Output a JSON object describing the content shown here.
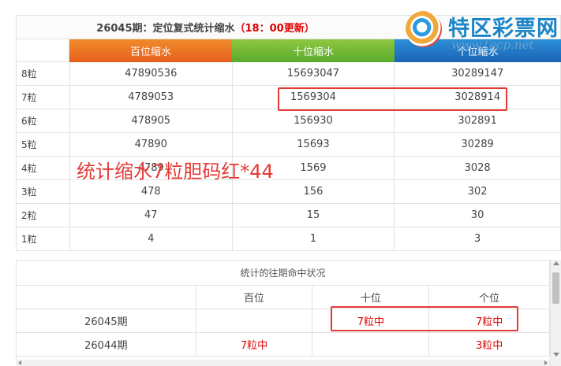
{
  "title": {
    "main": "26045期：定位复式统计缩水",
    "update": "（18：00更新）"
  },
  "columns": {
    "bai": "百位缩水",
    "shi": "十位缩水",
    "ge": "个位缩水"
  },
  "rows": [
    {
      "label": "8粒",
      "bai": "47890536",
      "shi": "15693047",
      "ge": "30289147"
    },
    {
      "label": "7粒",
      "bai": "4789053",
      "shi": "1569304",
      "ge": "3028914"
    },
    {
      "label": "6粒",
      "bai": "478905",
      "shi": "156930",
      "ge": "302891"
    },
    {
      "label": "5粒",
      "bai": "47890",
      "shi": "15693",
      "ge": "30289"
    },
    {
      "label": "4粒",
      "bai": "4789",
      "shi": "1569",
      "ge": "3028"
    },
    {
      "label": "3粒",
      "bai": "478",
      "shi": "156",
      "ge": "302"
    },
    {
      "label": "2粒",
      "bai": "47",
      "shi": "15",
      "ge": "30"
    },
    {
      "label": "1粒",
      "bai": "4",
      "shi": "1",
      "ge": "3"
    }
  ],
  "logo": {
    "name": "特区彩票网",
    "url": "www.tqcp.net"
  },
  "overlay_text": "统计缩水7粒胆码红*44",
  "history": {
    "title": "统计的往期命中状况",
    "headers": [
      "",
      "百位",
      "十位",
      "个位"
    ],
    "rows": [
      {
        "period": "26045期",
        "bai": "",
        "shi": "7粒中",
        "ge": "7粒中"
      },
      {
        "period": "26044期",
        "bai": "7粒中",
        "shi": "",
        "ge": "3粒中"
      }
    ]
  },
  "colors": {
    "bai_header": "#e8601e",
    "shi_header": "#5aab2e",
    "ge_header": "#1b63b5",
    "highlight": "#e53935",
    "hit_text": "#e00000"
  }
}
